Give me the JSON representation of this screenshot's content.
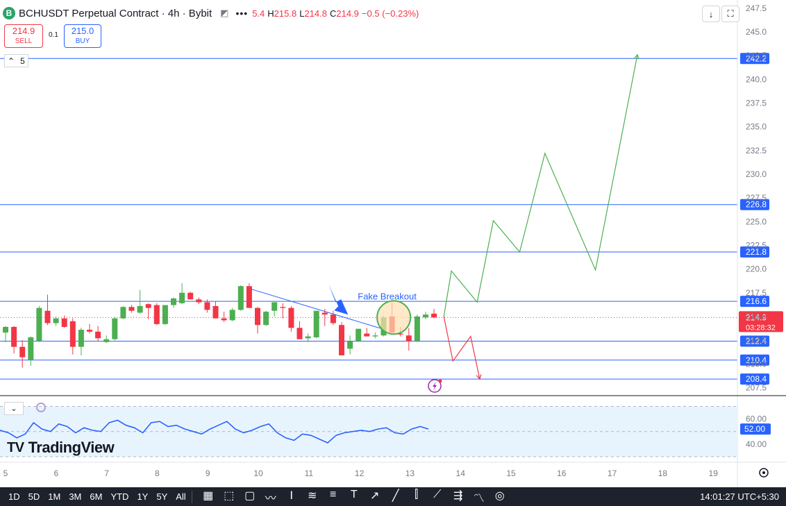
{
  "header": {
    "symbol": "BCHUSDT Perpetual Contract · 4h · Bybit",
    "coin_glyph": "B",
    "ohlc": [
      {
        "k": "",
        "v": "5.4"
      },
      {
        "k": "H",
        "v": "215.8"
      },
      {
        "k": "L",
        "v": "214.8"
      },
      {
        "k": "C",
        "v": "214.9"
      },
      {
        "k": "",
        "v": "−0.5 (−0.23%)"
      }
    ]
  },
  "trade": {
    "sell_price": "214.9",
    "sell_label": "SELL",
    "spread": "0.1",
    "buy_price": "215.0",
    "buy_label": "BUY"
  },
  "collapse_label": "5",
  "icons": {
    "visibility": "eye-slash-icon",
    "more": "more-dots-icon",
    "download": "download-arrow-icon",
    "fullscreen": "fullscreen-icon",
    "alert": "lightning-alert-icon",
    "settings": "gear-icon"
  },
  "chart_data": {
    "type": "candlestick",
    "y_axis": {
      "range": [
        206.8,
        248.0
      ],
      "ticks": [
        "247.5",
        "245.0",
        "242.5",
        "240.0",
        "237.5",
        "235.0",
        "232.5",
        "230.0",
        "227.5",
        "225.0",
        "222.5",
        "220.0",
        "217.5",
        "215.0",
        "212.5",
        "210.0",
        "207.5"
      ]
    },
    "x_axis": {
      "labels": [
        "5",
        "6",
        "7",
        "8",
        "9",
        "10",
        "11",
        "12",
        "13",
        "14",
        "15",
        "16",
        "17",
        "18",
        "19"
      ],
      "range": [
        5.0,
        19.0
      ]
    },
    "candles": [
      [
        213.3,
        214.0,
        212.3,
        213.9
      ],
      [
        213.9,
        214.0,
        211.1,
        211.8
      ],
      [
        211.8,
        212.5,
        209.6,
        210.7
      ],
      [
        210.4,
        212.9,
        209.8,
        212.8
      ],
      [
        212.4,
        216.1,
        212.3,
        215.9
      ],
      [
        215.6,
        217.3,
        214.1,
        214.3
      ],
      [
        214.3,
        215.0,
        214.0,
        214.8
      ],
      [
        214.8,
        215.1,
        213.8,
        213.9
      ],
      [
        214.5,
        214.8,
        211.0,
        211.8
      ],
      [
        211.8,
        213.8,
        210.9,
        213.6
      ],
      [
        213.6,
        214.2,
        213.2,
        213.4
      ],
      [
        213.4,
        214.0,
        212.4,
        212.7
      ],
      [
        212.3,
        213.0,
        212.2,
        212.6
      ],
      [
        212.6,
        214.9,
        212.5,
        214.8
      ],
      [
        214.8,
        216.1,
        214.7,
        216.0
      ],
      [
        216.0,
        216.2,
        215.4,
        215.6
      ],
      [
        215.4,
        217.8,
        215.3,
        216.1
      ],
      [
        216.3,
        216.4,
        214.7,
        215.9
      ],
      [
        216.2,
        216.4,
        214.1,
        214.2
      ],
      [
        214.2,
        216.2,
        214.1,
        216.2
      ],
      [
        216.2,
        217.0,
        215.9,
        216.9
      ],
      [
        216.4,
        218.5,
        216.3,
        217.5
      ],
      [
        217.5,
        217.6,
        216.8,
        216.8
      ],
      [
        216.8,
        217.0,
        216.3,
        216.5
      ],
      [
        216.5,
        216.8,
        215.4,
        215.7
      ],
      [
        216.1,
        216.6,
        214.8,
        214.8
      ],
      [
        214.8,
        215.5,
        214.4,
        214.6
      ],
      [
        214.6,
        215.9,
        214.5,
        215.7
      ],
      [
        215.7,
        218.3,
        215.6,
        218.2
      ],
      [
        218.2,
        218.5,
        215.9,
        215.9
      ],
      [
        215.9,
        216.0,
        213.2,
        214.1
      ],
      [
        214.1,
        215.6,
        214.0,
        215.5
      ],
      [
        215.6,
        216.5,
        215.0,
        216.5
      ],
      [
        216.0,
        216.4,
        214.8,
        215.9
      ],
      [
        215.9,
        216.1,
        213.4,
        213.8
      ],
      [
        213.8,
        214.5,
        212.6,
        212.6
      ],
      [
        212.7,
        213.2,
        212.3,
        212.9
      ],
      [
        212.8,
        215.6,
        212.7,
        215.6
      ],
      [
        215.4,
        215.8,
        214.0,
        215.2
      ],
      [
        215.2,
        215.6,
        214.1,
        214.3
      ],
      [
        214.1,
        214.4,
        210.9,
        210.9
      ],
      [
        211.6,
        213.0,
        211.0,
        212.4
      ],
      [
        212.4,
        213.7,
        212.3,
        213.7
      ],
      [
        213.2,
        213.8,
        212.9,
        212.9
      ],
      [
        212.9,
        213.3,
        212.7,
        213.0
      ],
      [
        213.0,
        215.1,
        212.9,
        214.9
      ],
      [
        215.0,
        216.5,
        213.6,
        213.3
      ],
      [
        213.2,
        213.9,
        212.9,
        213.1
      ],
      [
        213.0,
        213.8,
        211.4,
        212.4
      ],
      [
        212.4,
        215.2,
        212.3,
        215.0
      ],
      [
        214.9,
        215.5,
        214.7,
        215.2
      ],
      [
        215.3,
        215.8,
        214.8,
        214.9
      ]
    ],
    "horizontal_levels": [
      242.2,
      226.8,
      221.8,
      216.6,
      212.4,
      210.4,
      208.4
    ],
    "current_price": {
      "value": 214.9,
      "label": "214.9",
      "countdown": "03:28:32"
    },
    "trend_line": [
      [
        9.85,
        217.9
      ],
      [
        12.45,
        213.7
      ]
    ],
    "annotation": {
      "text": "Fake Breakout",
      "x": 12.6,
      "y": 217.1,
      "color": "#2962ff"
    },
    "highlight_circle": {
      "x": 12.68,
      "y": 214.9
    },
    "projection_bullish": [
      [
        13.67,
        215.0
      ],
      [
        13.82,
        219.8
      ],
      [
        14.33,
        216.5
      ],
      [
        14.65,
        225.1
      ],
      [
        15.17,
        221.8
      ],
      [
        15.67,
        232.2
      ],
      [
        16.67,
        219.9
      ],
      [
        17.5,
        242.6
      ]
    ],
    "projection_bearish": [
      [
        13.67,
        215.0
      ],
      [
        13.85,
        210.3
      ],
      [
        14.2,
        212.9
      ],
      [
        14.38,
        208.4
      ]
    ],
    "rsi": {
      "range": [
        30.0,
        73.0
      ],
      "ticks": [
        "60.00",
        "40.00"
      ],
      "current_label": "52.00",
      "values": [
        51,
        49,
        45,
        48,
        57,
        52,
        50,
        56,
        54,
        49,
        53,
        51,
        50,
        57,
        59,
        55,
        53,
        49,
        57,
        58,
        54,
        55,
        52,
        50,
        48,
        52,
        55,
        58,
        52,
        49,
        51,
        54,
        56,
        49,
        45,
        43,
        48,
        47,
        44,
        41,
        47,
        49,
        50,
        51,
        50,
        52,
        53,
        49,
        48,
        52,
        54,
        52
      ]
    },
    "colors": {
      "up": "#4caf50",
      "down": "#f23645",
      "level": "#2962ff",
      "trend": "#2962ff",
      "bull": "#4caf50",
      "bear": "#f23645",
      "rsi": "#2962ff",
      "rsi_band": "#e8f4fd"
    }
  },
  "logo": {
    "mark": "TV",
    "text": "TradingView"
  },
  "toolbar": {
    "timeframes": [
      "1D",
      "5D",
      "1M",
      "3M",
      "6M",
      "YTD",
      "1Y",
      "5Y",
      "All"
    ],
    "tools": [
      "calendar-range-icon",
      "select-icon",
      "rectangle-icon",
      "path-icon",
      "fib-icon",
      "price-range-icon",
      "channel-icon",
      "text-icon",
      "arrow-icon",
      "trend-line-icon",
      "pitchfork-icon",
      "trend-angle-icon",
      "regression-icon",
      "brush-icon",
      "anchor-icon"
    ],
    "clock": "14:01:27 UTC+5:30"
  }
}
